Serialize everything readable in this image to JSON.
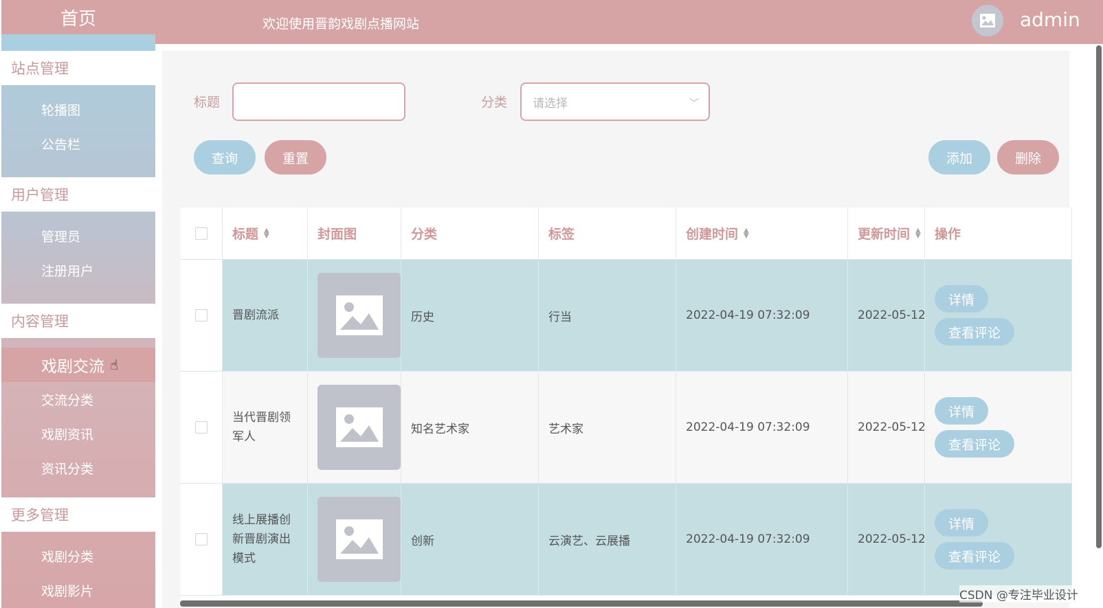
{
  "sidebar": {
    "home": "首页",
    "groups": [
      {
        "label": "站点管理",
        "items": [
          "轮播图",
          "公告栏"
        ]
      },
      {
        "label": "用户管理",
        "items": [
          "管理员",
          "注册用户"
        ]
      },
      {
        "label": "内容管理",
        "items": [
          "戏剧交流",
          "交流分类",
          "戏剧资讯",
          "资讯分类"
        ]
      },
      {
        "label": "更多管理",
        "items": [
          "戏剧分类",
          "戏剧影片"
        ]
      }
    ],
    "active_item": "戏剧交流"
  },
  "header": {
    "welcome": "欢迎使用晋韵戏剧点播网站",
    "username": "admin",
    "avatar_icon": "image-icon"
  },
  "filters": {
    "title_label": "标题",
    "title_value": "",
    "category_label": "分类",
    "category_placeholder": "请选择"
  },
  "buttons": {
    "query": "查询",
    "reset": "重置",
    "add": "添加",
    "delete": "删除"
  },
  "table": {
    "columns": [
      "标题",
      "封面图",
      "分类",
      "标签",
      "创建时间",
      "更新时间",
      "操作"
    ],
    "rows": [
      {
        "title": "晋剧流派",
        "category": "历史",
        "tags": "行当",
        "created": "2022-04-19 07:32:09",
        "updated": "2022-05-12"
      },
      {
        "title": "当代晋剧领军人",
        "category": "知名艺术家",
        "tags": "艺术家",
        "created": "2022-04-19 07:32:09",
        "updated": "2022-05-12"
      },
      {
        "title": "线上展播创新晋剧演出模式",
        "category": "创新",
        "tags": "云演艺、云展播",
        "created": "2022-04-19 07:32:09",
        "updated": "2022-05-12"
      }
    ],
    "action_detail": "详情",
    "action_comments": "查看评论"
  },
  "watermark": "CSDN @专注毕业设计",
  "colors": {
    "accent_pink": "#d6a4a5",
    "accent_blue": "#a9cfe0",
    "row_teal": "#c4dee2"
  }
}
